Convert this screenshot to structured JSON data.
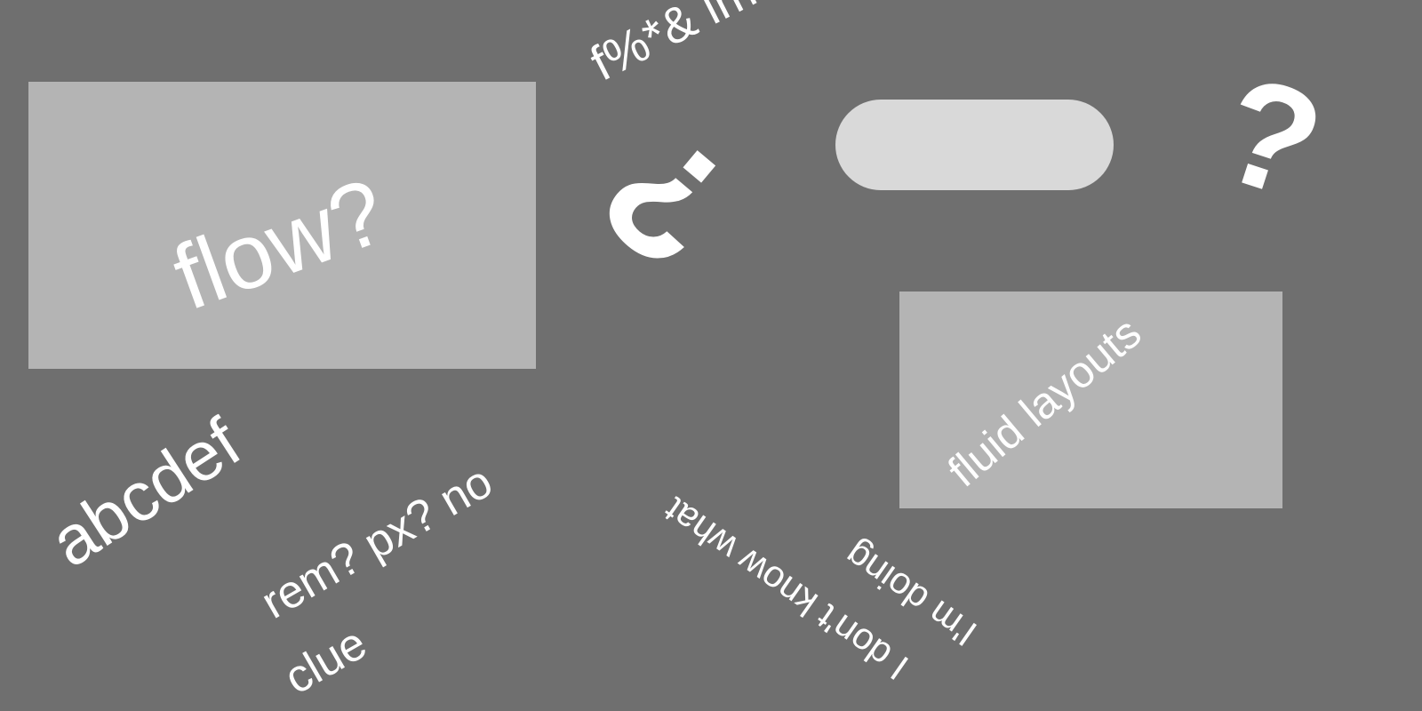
{
  "background_color": "#6f6f6f",
  "box_color": "#b4b4b4",
  "pill_color": "#d9d9d9",
  "text_color": "#ffffff",
  "texts": {
    "flow": "flow?",
    "symbols": "f%*& images",
    "abcdef": "abcdef",
    "rem_line1": "rem? px? no",
    "rem_line2": "clue",
    "dont_know": "I don't know what",
    "im_doing": "I'm doing",
    "fluid": "fluid layouts"
  },
  "glyphs": {
    "tilted_question_mark": "?",
    "question_mark": "?"
  }
}
